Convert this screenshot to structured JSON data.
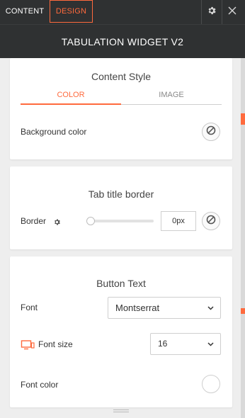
{
  "tabs": {
    "content": "CONTENT",
    "design": "DESIGN"
  },
  "header": {
    "title": "TABULATION WIDGET V2"
  },
  "content_style": {
    "title": "Content Style",
    "subtab_color": "COLOR",
    "subtab_image": "IMAGE",
    "background_color_label": "Background color"
  },
  "tab_title_border": {
    "title": "Tab title border",
    "border_label": "Border",
    "border_value": "0px"
  },
  "button_text": {
    "title": "Button Text",
    "font_label": "Font",
    "font_value": "Montserrat",
    "font_size_label": "Font size",
    "font_size_value": "16",
    "font_color_label": "Font color"
  },
  "colors": {
    "accent": "#ff6a3d",
    "header_bg": "#2f3132",
    "panel_bg": "#eeeeee"
  },
  "icons": [
    "gear-icon",
    "close-icon",
    "no-color-icon",
    "settings-gear-icon",
    "desktop-icon",
    "chevron-down-icon"
  ]
}
